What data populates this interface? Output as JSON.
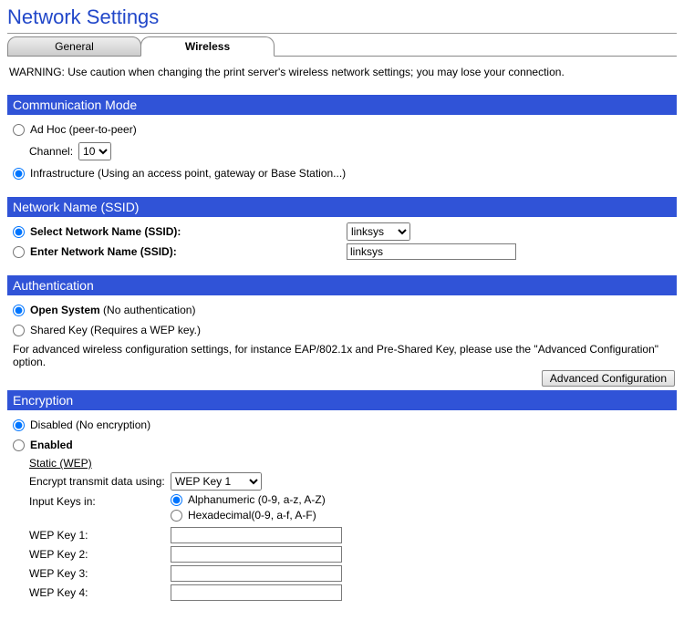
{
  "page_title": "Network Settings",
  "tabs": {
    "general": "General",
    "wireless": "Wireless"
  },
  "warning": "WARNING: Use caution when changing the print server's wireless network settings; you may lose your connection.",
  "comm_mode": {
    "header": "Communication Mode",
    "adhoc_label": "Ad Hoc (peer-to-peer)",
    "channel_label": "Channel:",
    "channel_options": [
      "10"
    ],
    "channel_value": "10",
    "infra_label": "Infrastructure (Using an access point, gateway or Base Station...)"
  },
  "ssid": {
    "header": "Network Name (SSID)",
    "select_label": "Select Network Name (SSID):",
    "select_value": "linksys",
    "select_options": [
      "linksys"
    ],
    "enter_label": "Enter Network Name (SSID):",
    "enter_value": "linksys"
  },
  "auth": {
    "header": "Authentication",
    "open_label": "Open System",
    "open_paren": "(No authentication)",
    "shared_label": "Shared Key (Requires a WEP key.)",
    "note": "For advanced wireless configuration settings, for instance EAP/802.1x and Pre-Shared Key, please use the \"Advanced Configuration\" option.",
    "adv_button": "Advanced Configuration"
  },
  "enc": {
    "header": "Encryption",
    "disabled_label": "Disabled (No encryption)",
    "enabled_label": "Enabled",
    "static_label": "Static (WEP)",
    "encrypt_label": "Encrypt transmit data using:",
    "encrypt_value": "WEP Key 1",
    "input_keys_label": "Input Keys in:",
    "alpha_label": "Alphanumeric (0-9, a-z, A-Z)",
    "hex_label": "Hexadecimal(0-9, a-f, A-F)",
    "wep1": "WEP Key 1:",
    "wep2": "WEP Key 2:",
    "wep3": "WEP Key 3:",
    "wep4": "WEP Key 4:"
  }
}
